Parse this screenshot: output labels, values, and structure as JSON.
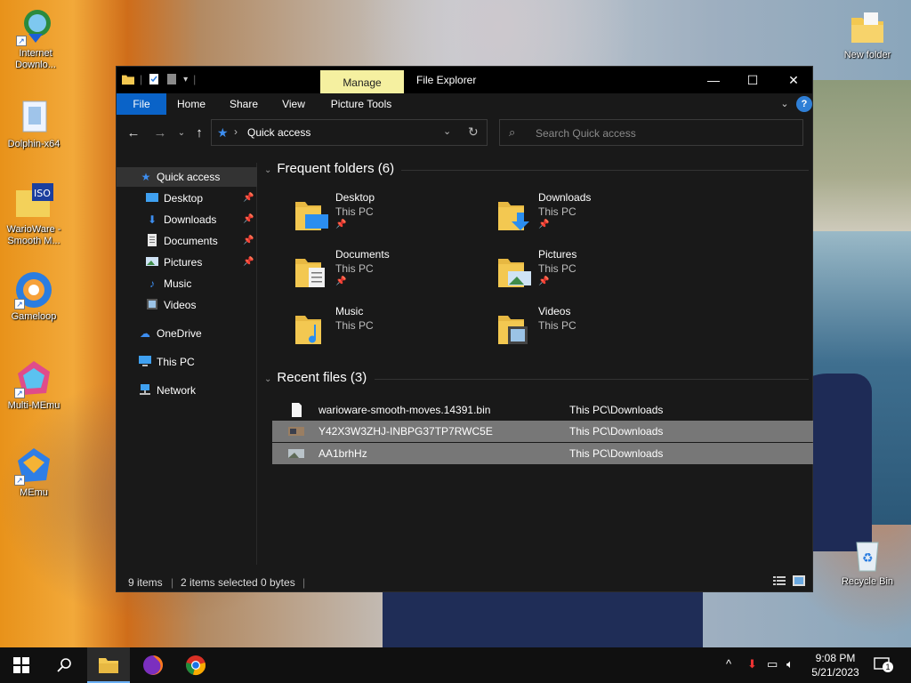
{
  "desktop": {
    "icons": [
      {
        "label": "Internet Downlo...",
        "icon": "idm-icon"
      },
      {
        "label": "Dolphin-x64",
        "icon": "file-icon"
      },
      {
        "label": "WarioWare - Smooth M...",
        "icon": "iso-icon"
      },
      {
        "label": "Gameloop",
        "icon": "gameloop-icon"
      },
      {
        "label": "Multi-MEmu",
        "icon": "multi-memu-icon"
      },
      {
        "label": "MEmu",
        "icon": "memu-icon"
      },
      {
        "label": "New folder",
        "icon": "folder-icon"
      },
      {
        "label": "Recycle Bin",
        "icon": "recycle-bin-icon"
      }
    ]
  },
  "window": {
    "title": "File Explorer",
    "context_tab": "Manage",
    "controls": {
      "minimize": "—",
      "maximize": "☐",
      "close": "✕"
    },
    "ribbon_tabs": [
      "File",
      "Home",
      "Share",
      "View",
      "Picture Tools"
    ],
    "address": {
      "path": "Quick access",
      "separator": "›"
    },
    "search": {
      "placeholder": "Search Quick access"
    },
    "help": "?",
    "nav_pane": [
      {
        "label": "Quick access",
        "icon": "star-icon",
        "selected": true
      },
      {
        "label": "Desktop",
        "icon": "desktop-icon",
        "pinned": true
      },
      {
        "label": "Downloads",
        "icon": "download-icon",
        "pinned": true
      },
      {
        "label": "Documents",
        "icon": "document-icon",
        "pinned": true
      },
      {
        "label": "Pictures",
        "icon": "pictures-icon",
        "pinned": true
      },
      {
        "label": "Music",
        "icon": "music-icon"
      },
      {
        "label": "Videos",
        "icon": "video-icon"
      },
      {
        "label": "OneDrive",
        "icon": "cloud-icon"
      },
      {
        "label": "This PC",
        "icon": "computer-icon"
      },
      {
        "label": "Network",
        "icon": "network-icon"
      }
    ],
    "frequent": {
      "header": "Frequent folders (6)",
      "folders": [
        {
          "name": "Desktop",
          "location": "This PC",
          "pinned": true
        },
        {
          "name": "Downloads",
          "location": "This PC",
          "pinned": true
        },
        {
          "name": "Documents",
          "location": "This PC",
          "pinned": true
        },
        {
          "name": "Pictures",
          "location": "This PC",
          "pinned": true
        },
        {
          "name": "Music",
          "location": "This PC",
          "pinned": false
        },
        {
          "name": "Videos",
          "location": "This PC",
          "pinned": false
        }
      ]
    },
    "recent": {
      "header": "Recent files (3)",
      "files": [
        {
          "name": "warioware-smooth-moves.14391.bin",
          "path": "This PC\\Downloads",
          "selected": false
        },
        {
          "name": "Y42X3W3ZHJ-INBPG37TP7RWC5E",
          "path": "This PC\\Downloads",
          "selected": true
        },
        {
          "name": "AA1brhHz",
          "path": "This PC\\Downloads",
          "selected": true
        }
      ]
    },
    "status": {
      "items": "9 items",
      "selected": "2 items selected",
      "size": "0 bytes"
    }
  },
  "taskbar": {
    "clock_time": "9:08 PM",
    "clock_date": "5/21/2023",
    "notifications": "1"
  },
  "colors": {
    "accent": "#0a63c8",
    "manage_tab": "#f5f0a0",
    "folder": "#f3c851"
  }
}
